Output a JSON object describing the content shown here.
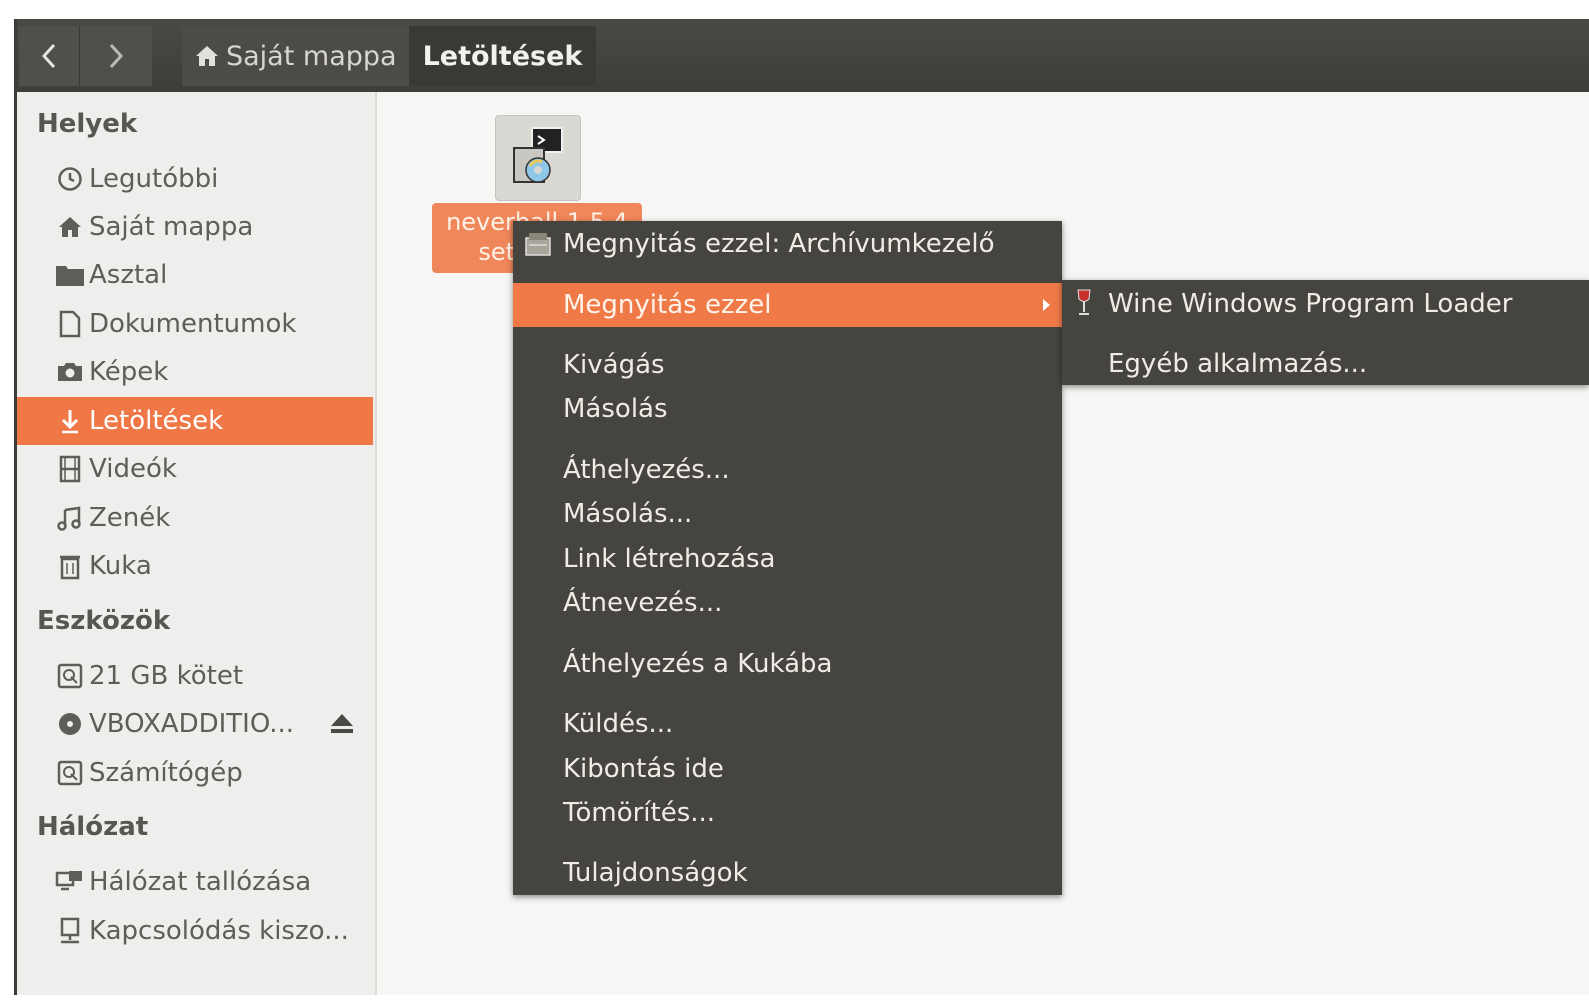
{
  "breadcrumb": {
    "home_label": "Saját mappa",
    "current_label": "Letöltések"
  },
  "sidebar": {
    "places_heading": "Helyek",
    "places": [
      {
        "label": "Legutóbbi",
        "icon": "clock-icon"
      },
      {
        "label": "Saját mappa",
        "icon": "home-icon"
      },
      {
        "label": "Asztal",
        "icon": "folder-icon"
      },
      {
        "label": "Dokumentumok",
        "icon": "document-icon"
      },
      {
        "label": "Képek",
        "icon": "camera-icon"
      },
      {
        "label": "Letöltések",
        "icon": "download-icon",
        "selected": true
      },
      {
        "label": "Videók",
        "icon": "film-icon"
      },
      {
        "label": "Zenék",
        "icon": "music-icon"
      },
      {
        "label": "Kuka",
        "icon": "trash-icon"
      }
    ],
    "devices_heading": "Eszközök",
    "devices": [
      {
        "label": "21 GB kötet",
        "icon": "drive-icon"
      },
      {
        "label": "VBOXADDITIO...",
        "icon": "disc-icon",
        "eject": true
      },
      {
        "label": "Számítógép",
        "icon": "computer-icon"
      }
    ],
    "network_heading": "Hálózat",
    "network": [
      {
        "label": "Hálózat tallózása",
        "icon": "network-icon"
      },
      {
        "label": "Kapcsolódás kiszo...",
        "icon": "server-icon"
      }
    ]
  },
  "file": {
    "label_line1": "neverball-1.5.4",
    "label_line2": "setup.exe",
    "icon": "installer-icon"
  },
  "context_menu": {
    "items": [
      {
        "label": "Megnyitás ezzel: Archívumkezelő",
        "icon": "archive-manager-icon"
      },
      {
        "label": "Megnyitás ezzel",
        "highlighted": true,
        "submenu": true
      },
      {
        "label": "Kivágás"
      },
      {
        "label": "Másolás"
      },
      {
        "label": "Áthelyezés..."
      },
      {
        "label": "Másolás..."
      },
      {
        "label": "Link létrehozása"
      },
      {
        "label": "Átnevezés..."
      },
      {
        "label": "Áthelyezés a Kukába"
      },
      {
        "label": "Küldés..."
      },
      {
        "label": "Kibontás ide"
      },
      {
        "label": "Tömörítés..."
      },
      {
        "label": "Tulajdonságok"
      }
    ]
  },
  "submenu": {
    "items": [
      {
        "label": "Wine Windows Program Loader",
        "icon": "wine-glass-icon"
      },
      {
        "label": "Egyéb alkalmazás..."
      }
    ]
  },
  "colors": {
    "accent": "#f07746",
    "header": "#3e3d39",
    "menu_bg": "#46443f",
    "sidebar_bg": "#efeeec"
  }
}
